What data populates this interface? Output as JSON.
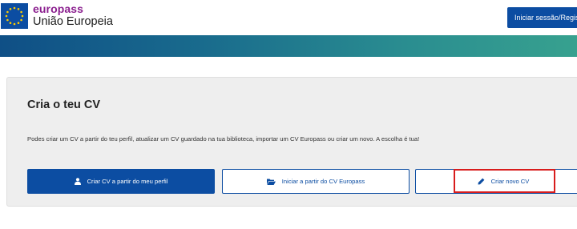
{
  "header": {
    "brand_name": "europass",
    "brand_sub": "União Europeia",
    "login_label": "Iniciar sessão/Regis"
  },
  "card": {
    "title": "Cria o teu CV",
    "description": "Podes criar um CV a partir do teu perfil, atualizar um CV guardado na tua biblioteca, importar um CV Europass ou criar um novo. A escolha é tua!",
    "buttons": {
      "from_profile": "Criar CV a partir do meu perfil",
      "from_europass": "Iniciar a partir do CV Europass",
      "new_cv": "Criar novo CV"
    }
  },
  "icons": {
    "flag": "eu-flag-icon",
    "from_profile": "user-icon",
    "from_europass": "folder-open-icon",
    "new_cv": "pencil-icon"
  },
  "colors": {
    "primary": "#0c4da2",
    "brand": "#8a1e8e",
    "highlight": "#d81c1c",
    "banner_start": "#0f4f86",
    "banner_end": "#37a18f"
  }
}
